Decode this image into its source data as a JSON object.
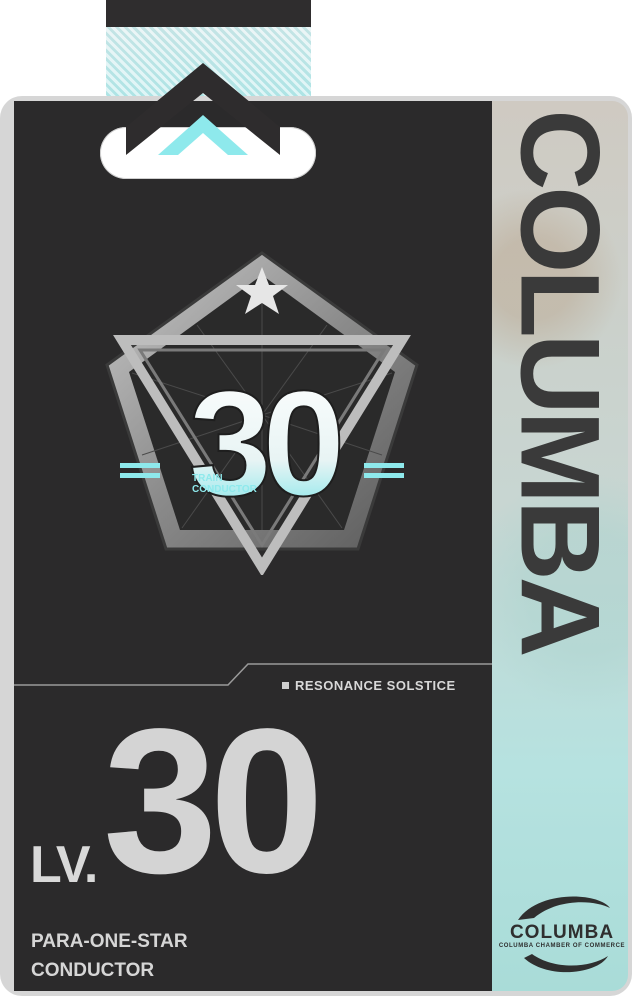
{
  "card": {
    "side_title": "COLUMBA",
    "tagline": "RESONANCE SOLSTICE",
    "level_prefix": "LV.",
    "level_value": "30",
    "rank_line1": "PARA-ONE-STAR",
    "rank_line2": "CONDUCTOR"
  },
  "badge": {
    "number": "30",
    "caption_line1": "TRAIN",
    "caption_line2": "CONDUCTOR"
  },
  "logo": {
    "word": "COLUMBA",
    "subtitle": "COLUMBA CHAMBER OF COMMERCE"
  },
  "icons": {
    "strap": "chevron-up-icon",
    "badge_star": "star-icon",
    "logo_mark": "swirl-emblem-icon"
  },
  "colors": {
    "panel_dark": "#2b2a2b",
    "accent_cyan": "#8ee9ec",
    "side_text": "#3a3a3a"
  }
}
